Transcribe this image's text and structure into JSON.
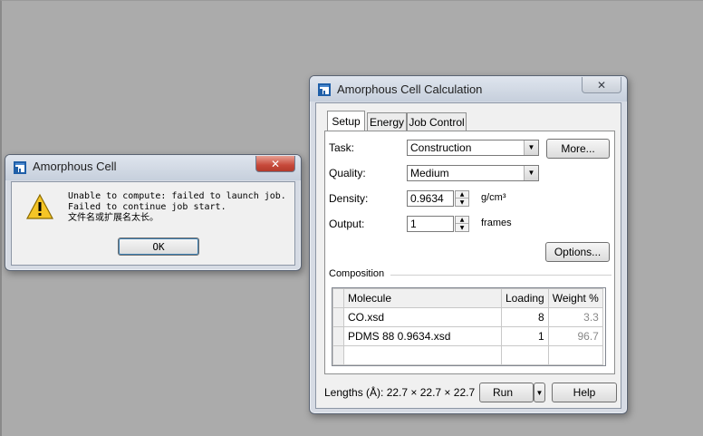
{
  "message_box": {
    "title": "Amorphous Cell",
    "close_glyph": "✕",
    "message_lines": [
      "Unable to compute: failed to launch job.",
      "Failed to continue job start.",
      "文件名或扩展名太长。"
    ],
    "ok_label": "OK"
  },
  "calc_dialog": {
    "title": "Amorphous Cell Calculation",
    "close_glyph": "✕",
    "tabs": [
      {
        "label": "Setup",
        "active": true
      },
      {
        "label": "Energy",
        "active": false
      },
      {
        "label": "Job Control",
        "active": false
      }
    ],
    "task": {
      "label": "Task:",
      "value": "Construction"
    },
    "more_label": "More...",
    "quality": {
      "label": "Quality:",
      "value": "Medium"
    },
    "density": {
      "label": "Density:",
      "value": "0.9634",
      "unit": "g/cm³"
    },
    "output": {
      "label": "Output:",
      "value": "1",
      "unit": "frames"
    },
    "options_label": "Options...",
    "composition": {
      "label": "Composition",
      "columns": [
        "Molecule",
        "Loading",
        "Weight %"
      ],
      "rows": [
        {
          "molecule": "CO.xsd",
          "loading": "8",
          "weight": "3.3"
        },
        {
          "molecule": "PDMS 88 0.9634.xsd",
          "loading": "1",
          "weight": "96.7"
        },
        {
          "molecule": "",
          "loading": "",
          "weight": ""
        }
      ]
    },
    "lengths": "Lengths (Å): 22.7 × 22.7 × 22.7",
    "run_label": "Run",
    "help_label": "Help"
  },
  "colors": {
    "desktop": "#ababab",
    "close_button": "#c7493a",
    "close_button_inactive": "#c9cfd8"
  }
}
